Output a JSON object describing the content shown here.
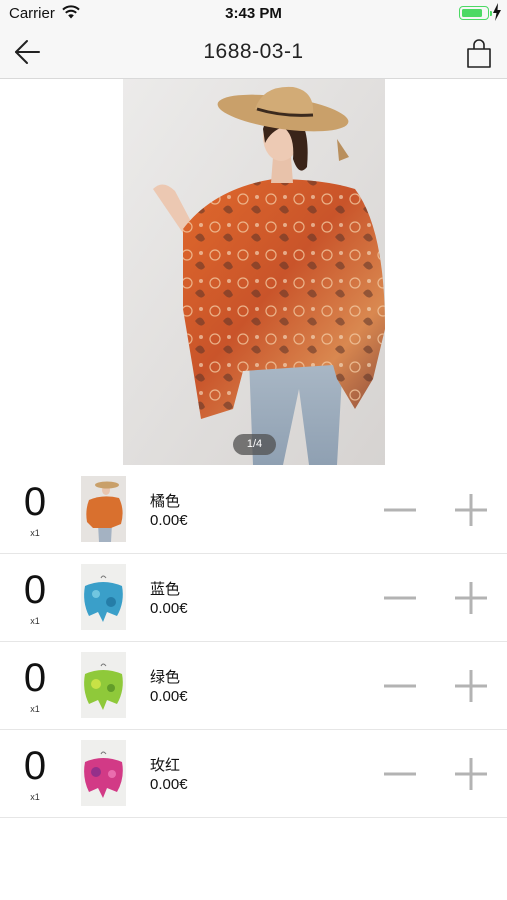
{
  "status_bar": {
    "carrier": "Carrier",
    "time": "3:43 PM",
    "battery_level": 0.85
  },
  "nav": {
    "title": "1688-03-1",
    "back_icon": "arrow-left-icon",
    "cart_icon": "shopping-bag-icon"
  },
  "gallery": {
    "page_indicator": "1/4",
    "current_page": 1,
    "total_pages": 4
  },
  "variants": [
    {
      "quantity": "0",
      "multiplier": "x1",
      "name": "橘色",
      "price": "0.00€",
      "color": "#d9702e"
    },
    {
      "quantity": "0",
      "multiplier": "x1",
      "name": "蓝色",
      "price": "0.00€",
      "color": "#3a9fc9"
    },
    {
      "quantity": "0",
      "multiplier": "x1",
      "name": "绿色",
      "price": "0.00€",
      "color": "#8fc93a"
    },
    {
      "quantity": "0",
      "multiplier": "x1",
      "name": "玫红",
      "price": "0.00€",
      "color": "#d23a86"
    }
  ],
  "colors": {
    "stepper_gray": "#b3b3b3",
    "battery_green": "#4cd964"
  }
}
